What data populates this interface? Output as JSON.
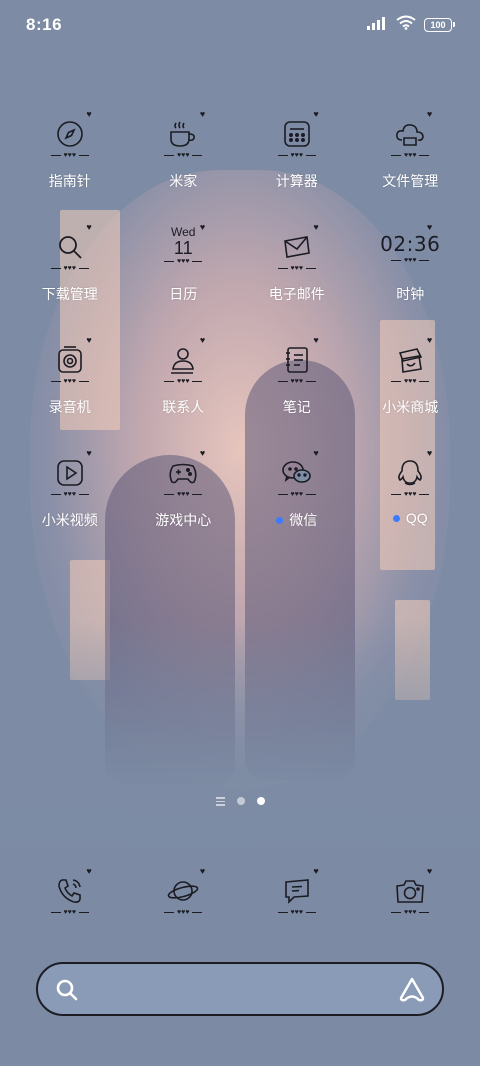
{
  "status_bar": {
    "time": "8:16",
    "battery": "100"
  },
  "apps": [
    {
      "label": "指南针",
      "icon": "compass-icon"
    },
    {
      "label": "米家",
      "icon": "cup-icon"
    },
    {
      "label": "计算器",
      "icon": "calculator-icon"
    },
    {
      "label": "文件管理",
      "icon": "cloud-folder-icon"
    },
    {
      "label": "下载管理",
      "icon": "magnifier-icon"
    },
    {
      "label": "日历",
      "icon": "calendar-icon",
      "weekday": "Wed",
      "day": "11"
    },
    {
      "label": "电子邮件",
      "icon": "envelope-icon"
    },
    {
      "label": "时钟",
      "icon": "clock-icon",
      "clock_text": "02:36"
    },
    {
      "label": "录音机",
      "icon": "recorder-icon"
    },
    {
      "label": "联系人",
      "icon": "contact-icon"
    },
    {
      "label": "笔记",
      "icon": "notebook-icon"
    },
    {
      "label": "小米商城",
      "icon": "shopping-bag-icon"
    },
    {
      "label": "小米视频",
      "icon": "play-icon"
    },
    {
      "label": "游戏中心",
      "icon": "gamepad-icon"
    },
    {
      "label": "微信",
      "icon": "wechat-icon",
      "badge_dot": true
    },
    {
      "label": "QQ",
      "icon": "qq-penguin-icon",
      "badge_dot": true
    }
  ],
  "dock": [
    {
      "icon": "phone-icon"
    },
    {
      "icon": "planet-browser-icon"
    },
    {
      "icon": "message-icon"
    },
    {
      "icon": "camera-icon"
    }
  ],
  "pager": {
    "pages": 3,
    "current": 3
  },
  "search": {
    "placeholder": ""
  },
  "colors": {
    "wallpaper": "#7c8ba3",
    "glow": "#ecc8be",
    "badge": "#3b7bff",
    "line": "#1c1c24"
  }
}
